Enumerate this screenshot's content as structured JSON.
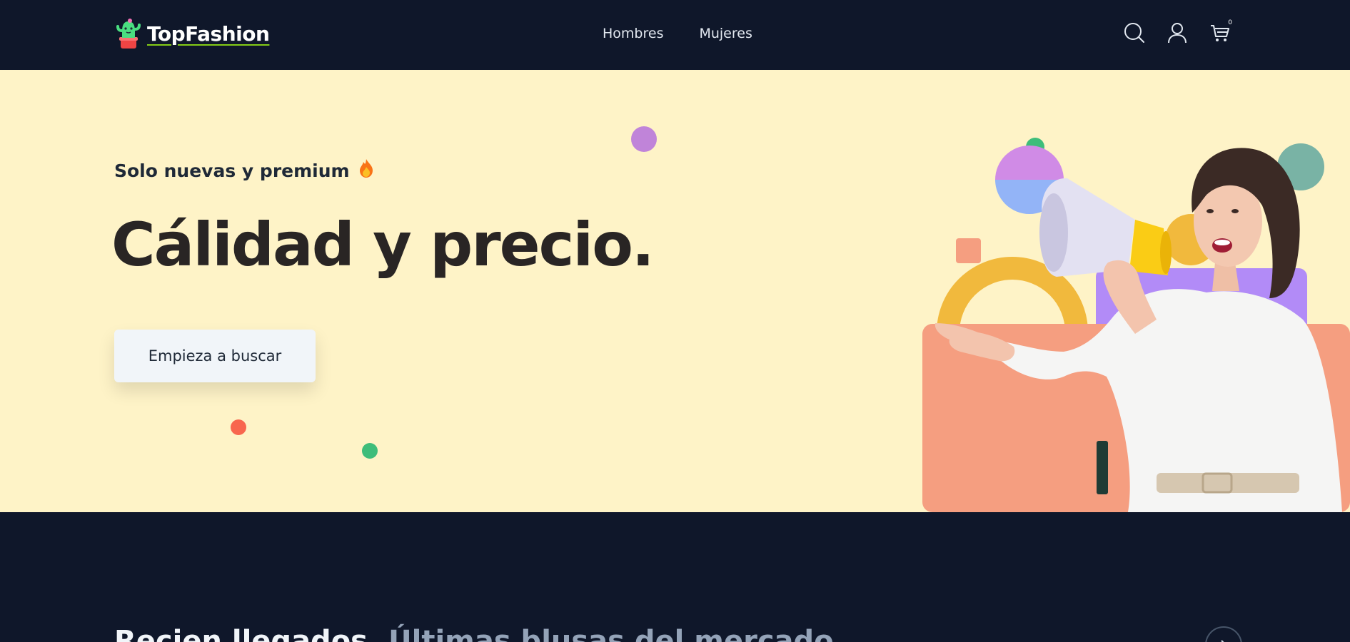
{
  "header": {
    "brand": "TopFashion",
    "nav": [
      "Hombres",
      "Mujeres"
    ],
    "icons": [
      "search-icon",
      "user-icon",
      "cart-icon"
    ],
    "cart_count": "0"
  },
  "hero": {
    "subtitle": "Solo nuevas y premium",
    "subtitle_emoji": "🔥",
    "headline": "Cálidad y precio.",
    "cta_label": "Empieza a buscar"
  },
  "section": {
    "title_strong": "Recien llegados.",
    "title_muted": "Últimas blusas del mercado"
  },
  "colors": {
    "header_bg": "#0f172a",
    "hero_bg": "#fef3c7",
    "accent_green": "#84cc16",
    "salmon": "#f59e80"
  }
}
